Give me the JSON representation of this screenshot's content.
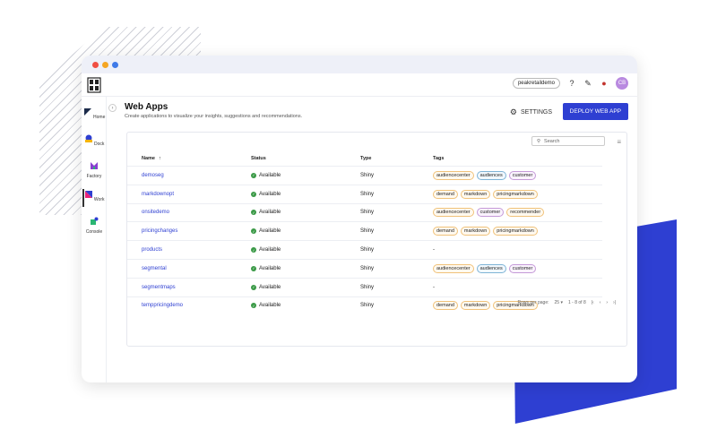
{
  "window_dots": [
    "#f04f43",
    "#f5a623",
    "#3f7ae8"
  ],
  "header": {
    "tenant": "peakretaildemo",
    "avatar": "CB"
  },
  "sidebar": {
    "items": [
      {
        "label": "Home",
        "icon": "home-icon"
      },
      {
        "label": "Dock",
        "icon": "dock-icon"
      },
      {
        "label": "Factory",
        "icon": "factory-icon"
      },
      {
        "label": "Work",
        "icon": "work-icon",
        "active": true
      },
      {
        "label": "Console",
        "icon": "console-icon"
      }
    ]
  },
  "page": {
    "title": "Web Apps",
    "subtitle": "Create applications to visualize your insights, suggestions and recommendations.",
    "settings_label": "SETTINGS",
    "deploy_label": "DEPLOY WEB APP"
  },
  "table": {
    "search_placeholder": "Search",
    "columns": [
      "Name",
      "Status",
      "Type",
      "Tags"
    ],
    "rows": [
      {
        "name": "demoseg",
        "status": "Available",
        "type": "Shiny",
        "tags": [
          [
            "audiencecenter",
            "orange"
          ],
          [
            "audiences",
            "blue"
          ],
          [
            "customer",
            "purple"
          ]
        ]
      },
      {
        "name": "markdownopt",
        "status": "Available",
        "type": "Shiny",
        "tags": [
          [
            "demand",
            "orange"
          ],
          [
            "markdown",
            "orange"
          ],
          [
            "pricingmarkdown",
            "orange"
          ]
        ]
      },
      {
        "name": "onsitedemo",
        "status": "Available",
        "type": "Shiny",
        "tags": [
          [
            "audiencecenter",
            "orange"
          ],
          [
            "customer",
            "purple"
          ],
          [
            "recommender",
            "orange"
          ]
        ]
      },
      {
        "name": "pricingchanges",
        "status": "Available",
        "type": "Shiny",
        "tags": [
          [
            "demand",
            "orange"
          ],
          [
            "markdown",
            "orange"
          ],
          [
            "pricingmarkdown",
            "orange"
          ]
        ]
      },
      {
        "name": "products",
        "status": "Available",
        "type": "Shiny",
        "tags": [],
        "empty": "-"
      },
      {
        "name": "segmental",
        "status": "Available",
        "type": "Shiny",
        "tags": [
          [
            "audiencecenter",
            "orange"
          ],
          [
            "audiences",
            "blue"
          ],
          [
            "customer",
            "purple"
          ]
        ]
      },
      {
        "name": "segmentmaps",
        "status": "Available",
        "type": "Shiny",
        "tags": [],
        "empty": "-"
      },
      {
        "name": "temppricingdemo",
        "status": "Available",
        "type": "Shiny",
        "tags": [
          [
            "demand",
            "orange"
          ],
          [
            "markdown",
            "orange"
          ],
          [
            "pricingmarkdown",
            "orange"
          ]
        ]
      }
    ],
    "pagination": {
      "rows_per_page_label": "Rows per page:",
      "rows_per_page": "25",
      "range": "1 - 8 of 8"
    }
  }
}
